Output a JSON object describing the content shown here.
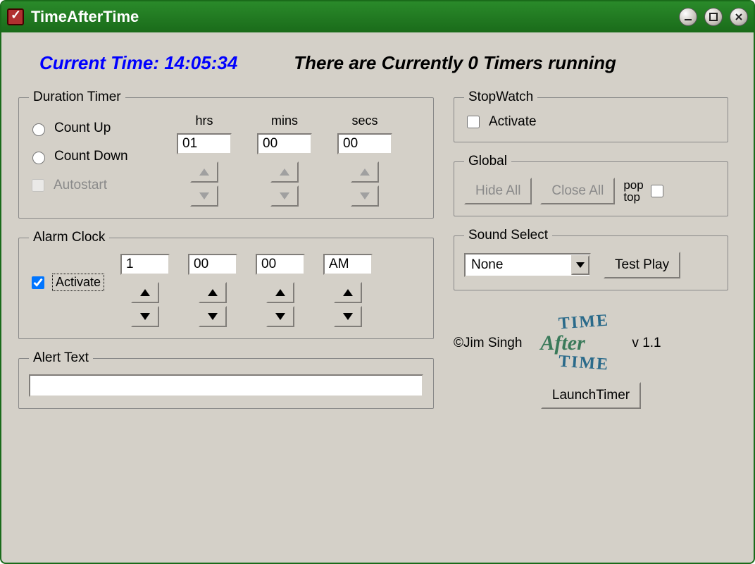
{
  "window": {
    "title": "TimeAfterTime"
  },
  "header": {
    "current_time_label": "Current Time: 14:05:34",
    "timers_running_label": "There are Currently 0 Timers running"
  },
  "duration": {
    "legend": "Duration Timer",
    "count_up_label": "Count Up",
    "count_down_label": "Count Down",
    "autostart_label": "Autostart",
    "hrs_label": "hrs",
    "mins_label": "mins",
    "secs_label": "secs",
    "hrs_value": "01",
    "mins_value": "00",
    "secs_value": "00"
  },
  "alarm": {
    "legend": "Alarm Clock",
    "activate_label": "Activate",
    "hour_value": "1",
    "min_value": "00",
    "sec_value": "00",
    "ampm_value": "AM"
  },
  "alert": {
    "legend": "Alert Text",
    "value": ""
  },
  "stopwatch": {
    "legend": "StopWatch",
    "activate_label": "Activate"
  },
  "global": {
    "legend": "Global",
    "hide_all_label": "Hide All",
    "close_all_label": "Close All",
    "pop_label": "pop",
    "top_label": "top"
  },
  "sound": {
    "legend": "Sound Select",
    "selected": "None",
    "test_play_label": "Test Play"
  },
  "about": {
    "copyright": "©Jim Singh",
    "logo_time1": "TIME",
    "logo_after": "After",
    "logo_time2": "TIME",
    "version": "v 1.1"
  },
  "launch": {
    "label": "LaunchTimer"
  }
}
